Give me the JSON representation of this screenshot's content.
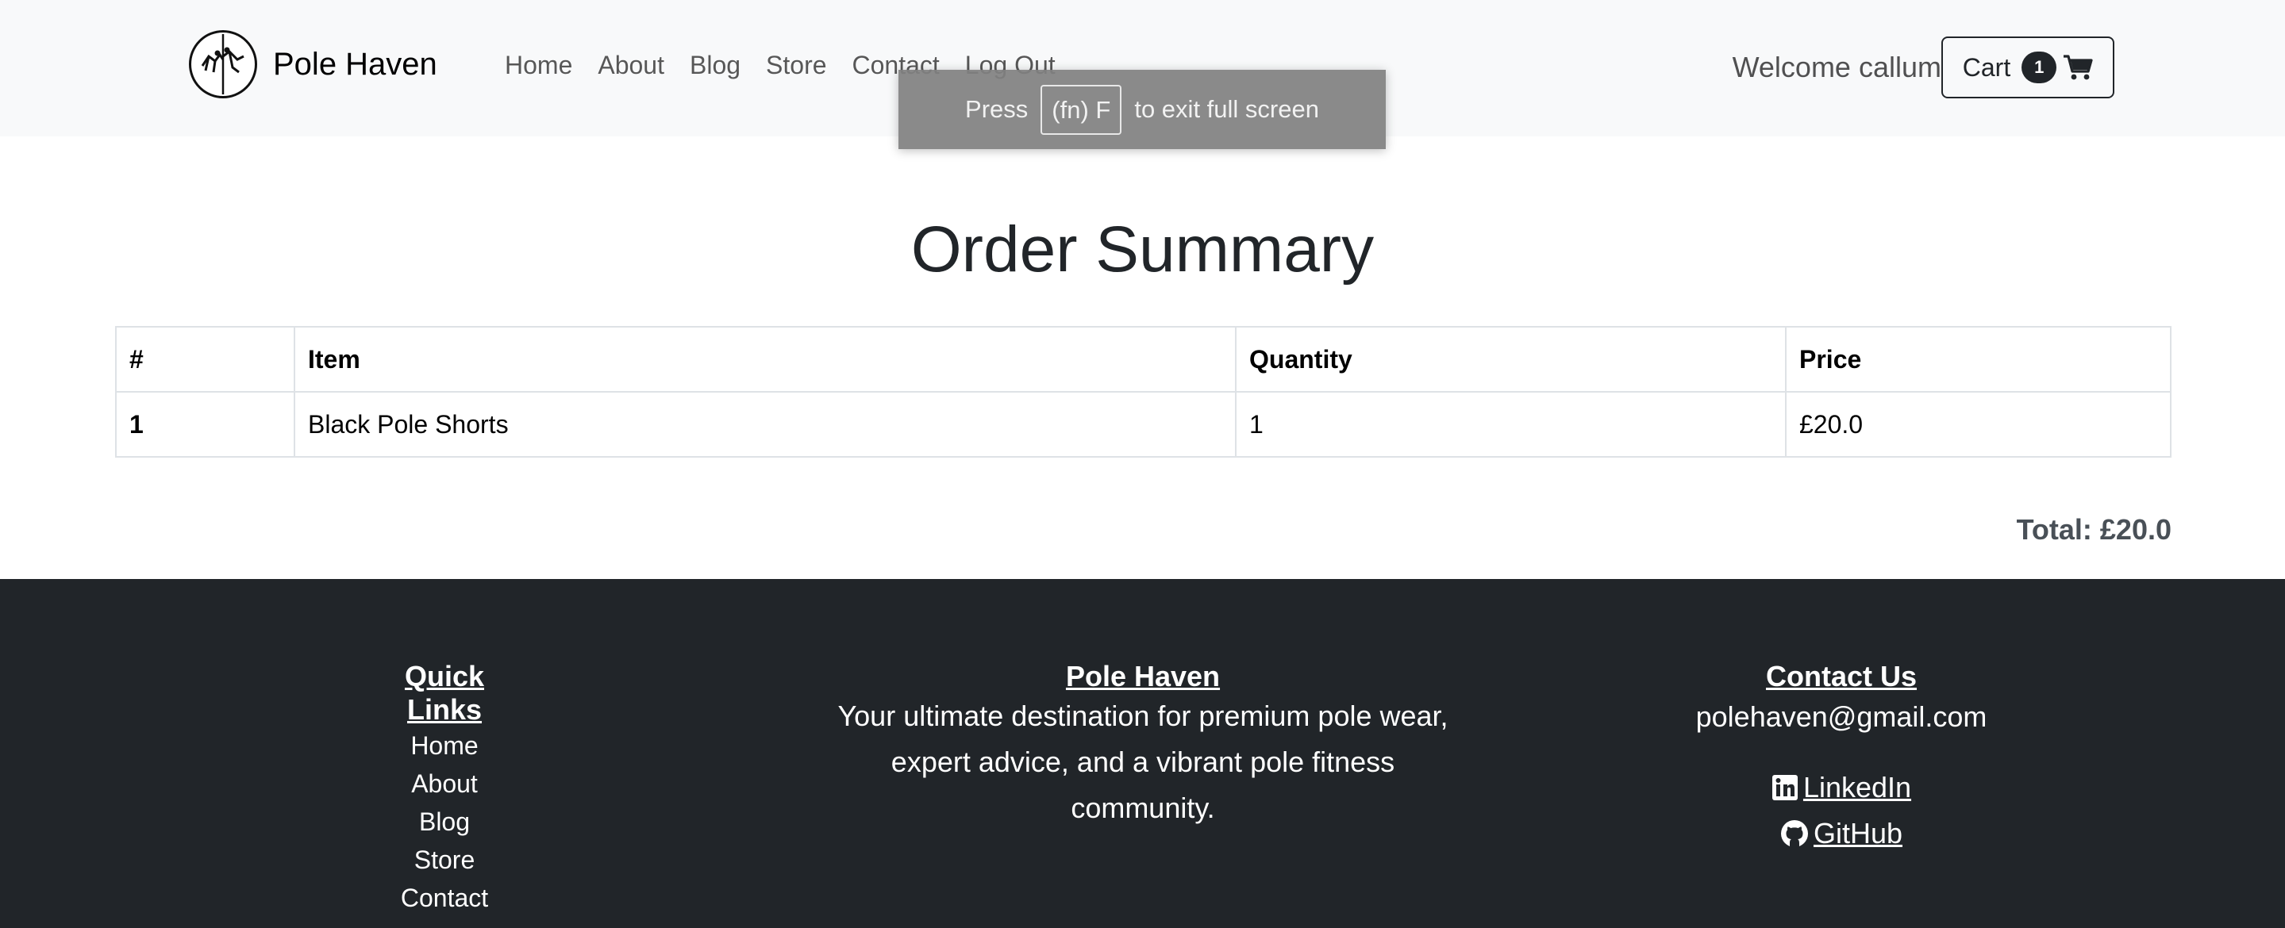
{
  "nav": {
    "brand": "Pole Haven",
    "links": [
      "Home",
      "About",
      "Blog",
      "Store",
      "Contact",
      "Log Out"
    ],
    "welcome": "Welcome callum",
    "cart_label": "Cart",
    "cart_count": "1"
  },
  "fullscreen_toast": {
    "prefix": "Press",
    "key": "(fn) F",
    "suffix": "to exit full screen"
  },
  "main": {
    "title": "Order Summary",
    "table": {
      "headers": [
        "#",
        "Item",
        "Quantity",
        "Price"
      ],
      "rows": [
        [
          "1",
          "Black Pole Shorts",
          "1",
          "£20.0"
        ]
      ]
    },
    "total": "Total: £20.0"
  },
  "footer": {
    "quick_links": {
      "heading": "Quick Links",
      "links": [
        "Home",
        "About",
        "Blog",
        "Store",
        "Contact"
      ]
    },
    "about": {
      "heading": "Pole Haven",
      "line1": "Your ultimate destination for premium pole wear,",
      "line2": "expert advice, and a vibrant pole fitness",
      "line3": "community."
    },
    "contact": {
      "heading": "Contact Us",
      "email": "polehaven@gmail.com",
      "linkedin": "LinkedIn",
      "github": "GitHub"
    }
  }
}
